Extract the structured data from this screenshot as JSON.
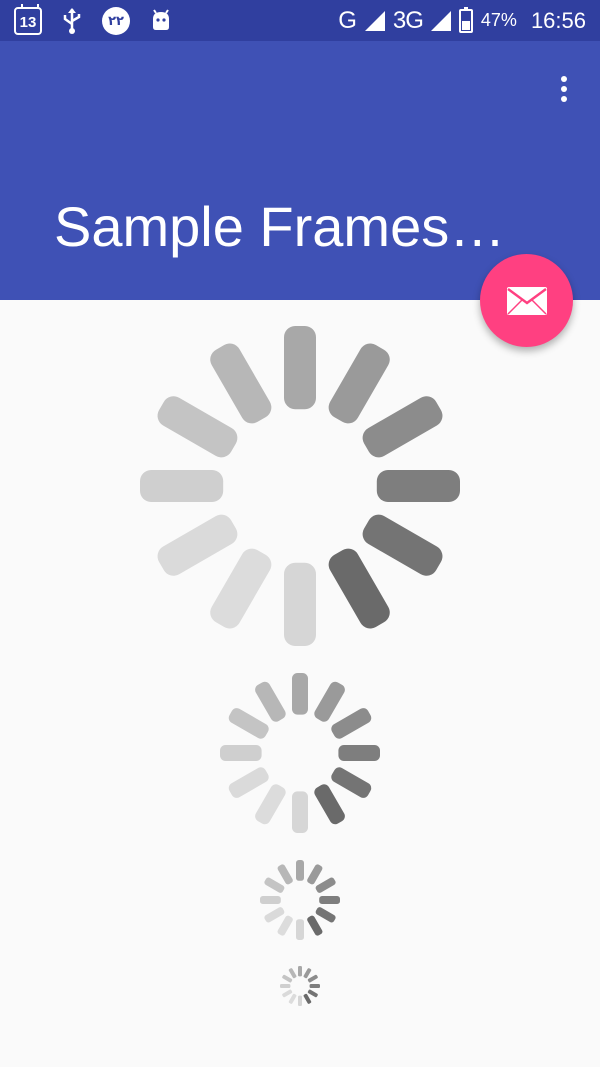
{
  "status_bar": {
    "calendar_date": "13",
    "badge_text": "۲۲",
    "network_type_1": "G",
    "network_type_2": "3G",
    "battery_percent": "47%",
    "time": "16:56",
    "icons": [
      "calendar-icon",
      "usb-icon",
      "notification-badge-icon",
      "android-icon",
      "signal-icon",
      "battery-icon"
    ]
  },
  "app_bar": {
    "title": "Sample FramesR…",
    "overflow_icon": "more-vert-icon",
    "color": "#3f51b5",
    "status_color": "#303f9f"
  },
  "fab": {
    "icon": "mail-icon",
    "color": "#ff4081"
  },
  "spinners": {
    "count": 4,
    "segments": 12,
    "icon": "loading-spinner-icon"
  }
}
